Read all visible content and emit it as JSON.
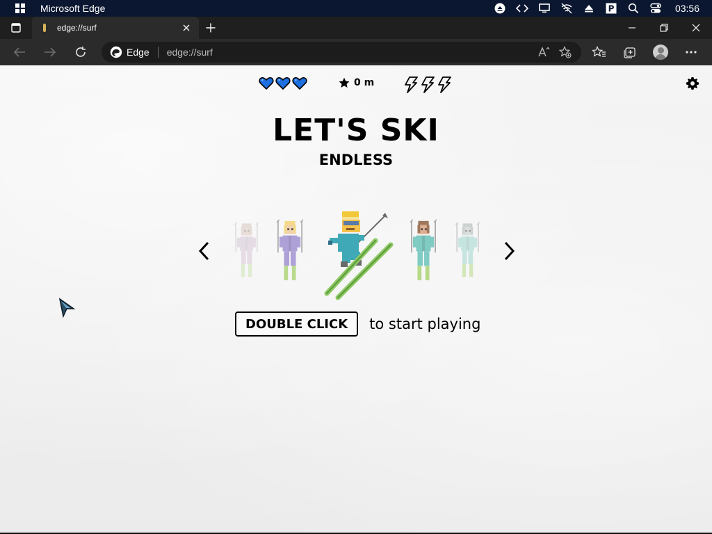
{
  "os": {
    "app_name": "Microsoft Edge",
    "clock": "03:56",
    "tray_icons": [
      "eject-icon",
      "code-icon",
      "display-icon",
      "network-off-icon",
      "upload-icon",
      "p-badge-icon",
      "search-icon",
      "toggle-icon"
    ]
  },
  "tabs": [
    {
      "title": "edge://surf",
      "active": true
    }
  ],
  "toolbar": {
    "site_label": "Edge",
    "url": "edge://surf"
  },
  "game": {
    "hearts": 3,
    "heart_color": "#1e6fe0",
    "score": "0 m",
    "boosts": 3,
    "title": "LET'S SKI",
    "mode": "ENDLESS",
    "start_button_label": "DOUBLE CLICK",
    "start_hint": "to start playing",
    "selected_character": 3,
    "characters": [
      {
        "skin": "#c9a08a",
        "suit": "#b89ab9",
        "hair": "#b89a8a"
      },
      {
        "skin": "#f0c89c",
        "suit": "#9a8ad0",
        "hair": "#f3d36a"
      },
      {
        "skin": "#f5c24a",
        "suit": "#3fa9b7",
        "hair": "#f2c83a"
      },
      {
        "skin": "#d9a07a",
        "suit": "#67c2b8",
        "hair": "#8a5a3a"
      },
      {
        "skin": "#b9c8c4",
        "suit": "#8fd1c6",
        "hair": "#9aa7a3"
      }
    ]
  }
}
